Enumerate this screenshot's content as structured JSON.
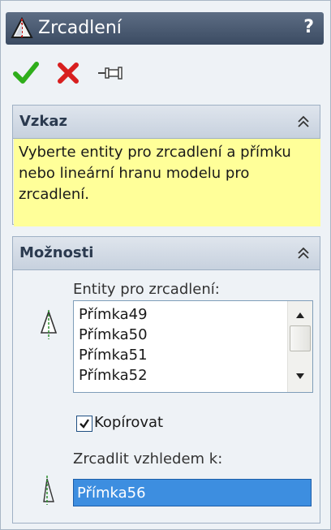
{
  "header": {
    "title": "Zrcadlení",
    "help_label": "?",
    "title_icon": "mirror-icon"
  },
  "toolbar": {
    "ok_icon": "checkmark-icon",
    "cancel_icon": "x-icon",
    "pin_icon": "pushpin-icon"
  },
  "message": {
    "title": "Vzkaz",
    "text": "Vyberte entity pro zrcadlení a přímku nebo lineární hranu modelu pro zrcadlení."
  },
  "options": {
    "title": "Možnosti",
    "entities_label": "Entity pro zrcadlení:",
    "entities": [
      "Přímka49",
      "Přímka50",
      "Přímka51",
      "Přímka52"
    ],
    "copy_label": "Kopírovat",
    "copy_checked": true,
    "mirror_about_label": "Zrcadlit vzhledem k:",
    "mirror_about_value": "Přímka56"
  },
  "colors": {
    "message_bg": "#ffff99",
    "selection_bg": "#3d8ee0",
    "ok_green": "#2fae1b",
    "cancel_red": "#d81f1f"
  }
}
